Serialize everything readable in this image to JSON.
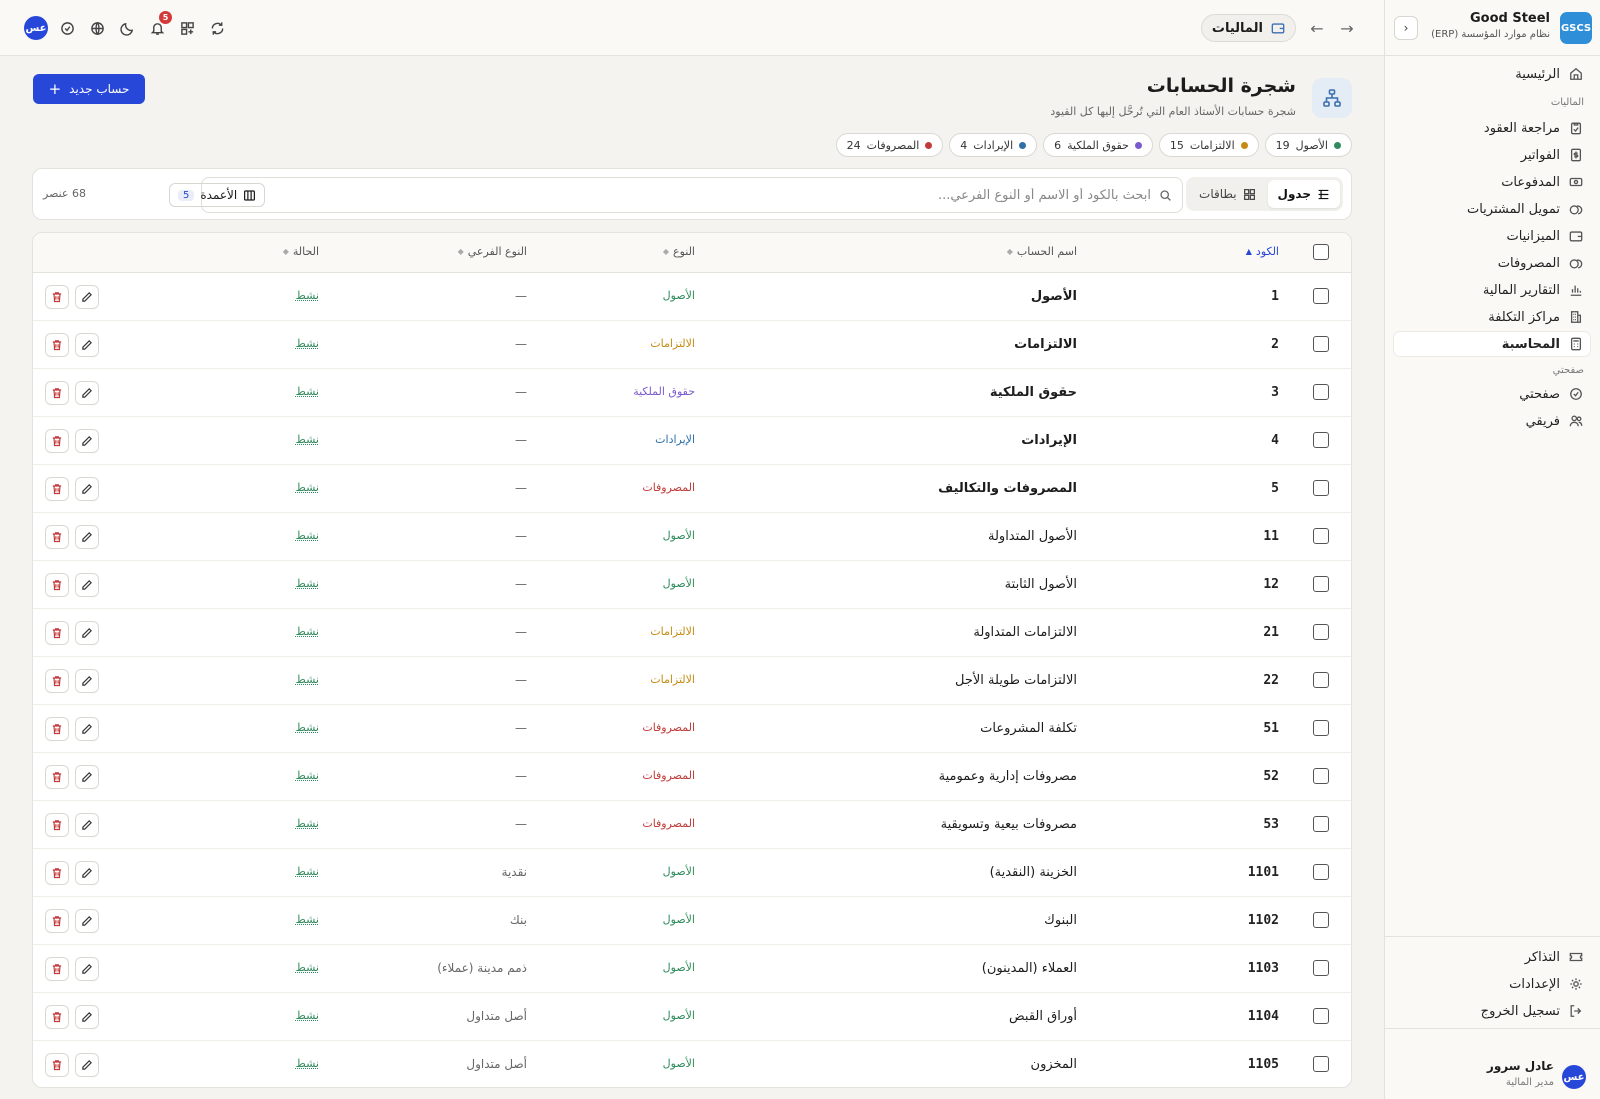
{
  "brand": {
    "logo": "GSCS",
    "name": "Good Steel",
    "subtitle": "نظام موارد المؤسسة (ERP)"
  },
  "sidebar": {
    "home": "الرئيسية",
    "section_finance": "الماليات",
    "finance_items": [
      {
        "label": "مراجعة العقود",
        "icon": "clipboard-check-icon"
      },
      {
        "label": "الفواتير",
        "icon": "invoice-icon"
      },
      {
        "label": "المدفوعات",
        "icon": "payment-icon"
      },
      {
        "label": "تمويل المشتريات",
        "icon": "coins-icon"
      },
      {
        "label": "الميزانيات",
        "icon": "wallet-icon"
      },
      {
        "label": "المصروفات",
        "icon": "coins-icon"
      },
      {
        "label": "التقارير المالية",
        "icon": "bar-chart-icon"
      },
      {
        "label": "مراكز التكلفة",
        "icon": "building-icon"
      },
      {
        "label": "المحاسبة",
        "icon": "calculator-icon"
      }
    ],
    "section_pages": "صفحتي",
    "page_items": [
      {
        "label": "صفحتي",
        "icon": "check-circle-icon"
      },
      {
        "label": "فريقي",
        "icon": "users-icon"
      }
    ],
    "bottom_items": [
      {
        "label": "التذاكر",
        "icon": "ticket-icon"
      },
      {
        "label": "الإعدادات",
        "icon": "gear-icon"
      },
      {
        "label": "تسجيل الخروج",
        "icon": "logout-icon"
      }
    ]
  },
  "user": {
    "initials": "عس",
    "name": "عادل سرور",
    "role": "مدير المالية"
  },
  "topbar": {
    "breadcrumb": "الماليات",
    "notifications": "5",
    "avatar": "عس"
  },
  "page": {
    "title": "شجرة الحسابات",
    "description": "شجرة حسابات الأستاذ العام التي تُرحَّل إليها كل القيود",
    "new_button": "حساب جديد"
  },
  "chips": [
    {
      "label": "الأصول",
      "count": "19",
      "color": "#2f8a5c"
    },
    {
      "label": "الالتزامات",
      "count": "15",
      "color": "#c48a14"
    },
    {
      "label": "حقوق الملكية",
      "count": "6",
      "color": "#7a5ad0"
    },
    {
      "label": "الإيرادات",
      "count": "4",
      "color": "#2e6fa8"
    },
    {
      "label": "المصروفات",
      "count": "24",
      "color": "#c23a3a"
    }
  ],
  "toolbar": {
    "view_table": "جدول",
    "view_cards": "بطاقات",
    "search_placeholder": "ابحث بالكود أو الاسم أو النوع الفرعي...",
    "columns_label": "الأعمدة",
    "columns_count": "5",
    "item_count": "68 عنصر"
  },
  "colors": {
    "assets": "#2f8a5c",
    "liabilities": "#c48a14",
    "equity": "#7a5ad0",
    "revenue": "#2e6fa8",
    "expenses": "#c23a3a",
    "accent": "#2747d8"
  },
  "table": {
    "headers": {
      "code": "الكود",
      "name": "اسم الحساب",
      "type": "النوع",
      "subtype": "النوع الفرعي",
      "status": "الحالة"
    },
    "rows": [
      {
        "code": "1",
        "name": "الأصول",
        "type": "الأصول",
        "type_key": "assets",
        "subtype": "—",
        "status": "نشط",
        "bold": true
      },
      {
        "code": "2",
        "name": "الالتزامات",
        "type": "الالتزامات",
        "type_key": "liabilities",
        "subtype": "—",
        "status": "نشط",
        "bold": true
      },
      {
        "code": "3",
        "name": "حقوق الملكية",
        "type": "حقوق الملكية",
        "type_key": "equity",
        "subtype": "—",
        "status": "نشط",
        "bold": true
      },
      {
        "code": "4",
        "name": "الإيرادات",
        "type": "الإيرادات",
        "type_key": "revenue",
        "subtype": "—",
        "status": "نشط",
        "bold": true
      },
      {
        "code": "5",
        "name": "المصروفات والتكاليف",
        "type": "المصروفات",
        "type_key": "expenses",
        "subtype": "—",
        "status": "نشط",
        "bold": true
      },
      {
        "code": "11",
        "name": "الأصول المتداولة",
        "type": "الأصول",
        "type_key": "assets",
        "subtype": "—",
        "status": "نشط",
        "bold": false
      },
      {
        "code": "12",
        "name": "الأصول الثابتة",
        "type": "الأصول",
        "type_key": "assets",
        "subtype": "—",
        "status": "نشط",
        "bold": false
      },
      {
        "code": "21",
        "name": "الالتزامات المتداولة",
        "type": "الالتزامات",
        "type_key": "liabilities",
        "subtype": "—",
        "status": "نشط",
        "bold": false
      },
      {
        "code": "22",
        "name": "الالتزامات طويلة الأجل",
        "type": "الالتزامات",
        "type_key": "liabilities",
        "subtype": "—",
        "status": "نشط",
        "bold": false
      },
      {
        "code": "51",
        "name": "تكلفة المشروعات",
        "type": "المصروفات",
        "type_key": "expenses",
        "subtype": "—",
        "status": "نشط",
        "bold": false
      },
      {
        "code": "52",
        "name": "مصروفات إدارية وعمومية",
        "type": "المصروفات",
        "type_key": "expenses",
        "subtype": "—",
        "status": "نشط",
        "bold": false
      },
      {
        "code": "53",
        "name": "مصروفات بيعية وتسويقية",
        "type": "المصروفات",
        "type_key": "expenses",
        "subtype": "—",
        "status": "نشط",
        "bold": false
      },
      {
        "code": "1101",
        "name": "الخزينة (النقدية)",
        "type": "الأصول",
        "type_key": "assets",
        "subtype": "نقدية",
        "status": "نشط",
        "bold": false
      },
      {
        "code": "1102",
        "name": "البنوك",
        "type": "الأصول",
        "type_key": "assets",
        "subtype": "بنك",
        "status": "نشط",
        "bold": false
      },
      {
        "code": "1103",
        "name": "العملاء (المدينون)",
        "type": "الأصول",
        "type_key": "assets",
        "subtype": "ذمم مدينة (عملاء)",
        "status": "نشط",
        "bold": false
      },
      {
        "code": "1104",
        "name": "أوراق القبض",
        "type": "الأصول",
        "type_key": "assets",
        "subtype": "أصل متداول",
        "status": "نشط",
        "bold": false
      },
      {
        "code": "1105",
        "name": "المخزون",
        "type": "الأصول",
        "type_key": "assets",
        "subtype": "أصل متداول",
        "status": "نشط",
        "bold": false
      }
    ]
  }
}
